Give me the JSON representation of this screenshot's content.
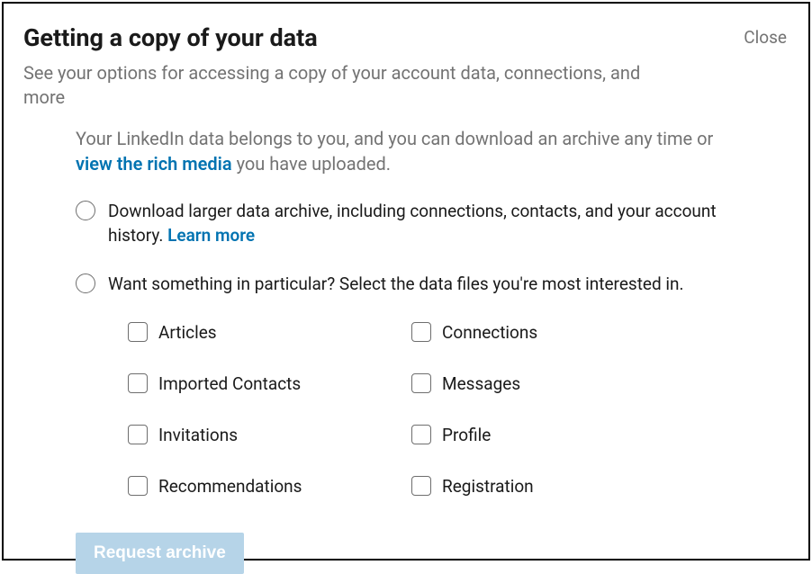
{
  "close_label": "Close",
  "heading": "Getting a copy of your data",
  "subheading": "See your options for accessing a copy of your account data, connections, and more",
  "intro_part1": "Your LinkedIn data belongs to you, and you can download an archive any time or ",
  "intro_link": "view the rich media",
  "intro_part2": " you have uploaded.",
  "option1_text": "Download larger data archive, including connections, contacts, and your account history. ",
  "option1_link": "Learn more",
  "option2_text": "Want something in particular? Select the data files you're most interested in.",
  "checkboxes": {
    "c0": "Articles",
    "c1": "Connections",
    "c2": "Imported Contacts",
    "c3": "Messages",
    "c4": "Invitations",
    "c5": "Profile",
    "c6": "Recommendations",
    "c7": "Registration"
  },
  "button_label": "Request archive"
}
